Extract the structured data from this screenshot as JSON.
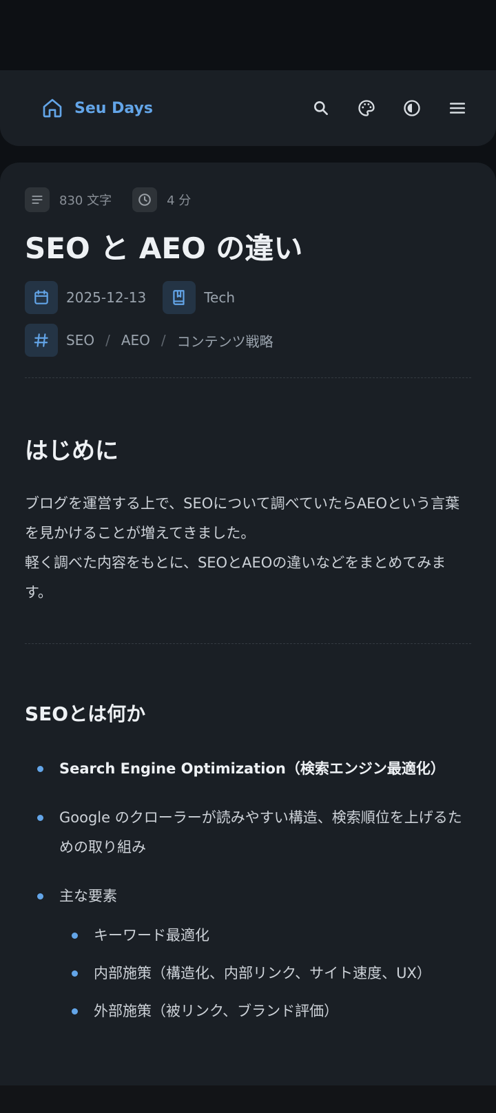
{
  "header": {
    "brand": "Seu Days",
    "icons": [
      "home-icon",
      "search-icon",
      "palette-icon",
      "contrast-icon",
      "menu-icon"
    ],
    "accent": "#63a5e8"
  },
  "post": {
    "word_count": "830 文字",
    "read_time": "4 分",
    "title": "SEO と AEO の違い",
    "date": "2025-12-13",
    "category": "Tech",
    "tags": [
      "SEO",
      "AEO",
      "コンテンツ戦略"
    ],
    "tag_separator": "/"
  },
  "content": {
    "intro_heading": "はじめに",
    "intro_paragraph_1": "ブログを運営する上で、SEOについて調べていたらAEOという言葉を見かけることが増えてきました。",
    "intro_paragraph_2": "軽く調べた内容をもとに、SEOとAEOの違いなどをまとめてみます。",
    "seo_heading": "SEOとは何か",
    "bullets": [
      "Search Engine Optimization（検索エンジン最適化）",
      "Google のクローラーが読みやすい構造、検索順位を上げるための取り組み",
      "主な要素"
    ],
    "sub_bullets": [
      "キーワード最適化",
      "内部施策（構造化、内部リンク、サイト速度、UX）",
      "外部施策（被リンク、ブランド評価）"
    ]
  }
}
